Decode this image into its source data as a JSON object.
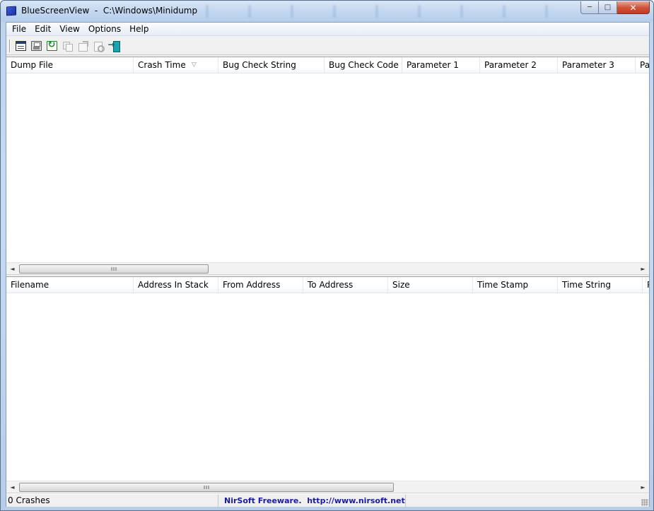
{
  "window": {
    "title": "BlueScreenView  -  C:\\Windows\\Minidump",
    "caption_buttons": {
      "minimize": "─",
      "maximize": "□",
      "close": "✕"
    }
  },
  "menu": {
    "items": [
      {
        "label": "File"
      },
      {
        "label": "Edit"
      },
      {
        "label": "View"
      },
      {
        "label": "Options"
      },
      {
        "label": "Help"
      }
    ]
  },
  "toolbar": {
    "buttons": [
      {
        "icon": "properties-icon",
        "enabled": true
      },
      {
        "icon": "save-icon",
        "enabled": false
      },
      {
        "icon": "refresh-icon",
        "enabled": true
      },
      {
        "icon": "copy-icon",
        "enabled": false
      },
      {
        "icon": "export-html-icon",
        "enabled": false
      },
      {
        "icon": "find-icon",
        "enabled": false
      },
      {
        "icon": "exit-icon",
        "enabled": true
      }
    ]
  },
  "crash_list": {
    "columns": [
      "Dump File",
      "Crash Time",
      "Bug Check String",
      "Bug Check Code",
      "Parameter 1",
      "Parameter 2",
      "Parameter 3",
      "Pa"
    ],
    "sorted_column": "Crash Time",
    "rows": []
  },
  "driver_list": {
    "columns": [
      "Filename",
      "Address In Stack",
      "From Address",
      "To Address",
      "Size",
      "Time Stamp",
      "Time String",
      "P"
    ],
    "rows": []
  },
  "scrollbar": {
    "left_arrow": "◄",
    "right_arrow": "►"
  },
  "status": {
    "crash_count": "0 Crashes",
    "link_text": "NirSoft Freeware.  http://www.nirsoft.net"
  },
  "colors": {
    "link": "#1a1aa6",
    "close_button": "#c23a22"
  }
}
